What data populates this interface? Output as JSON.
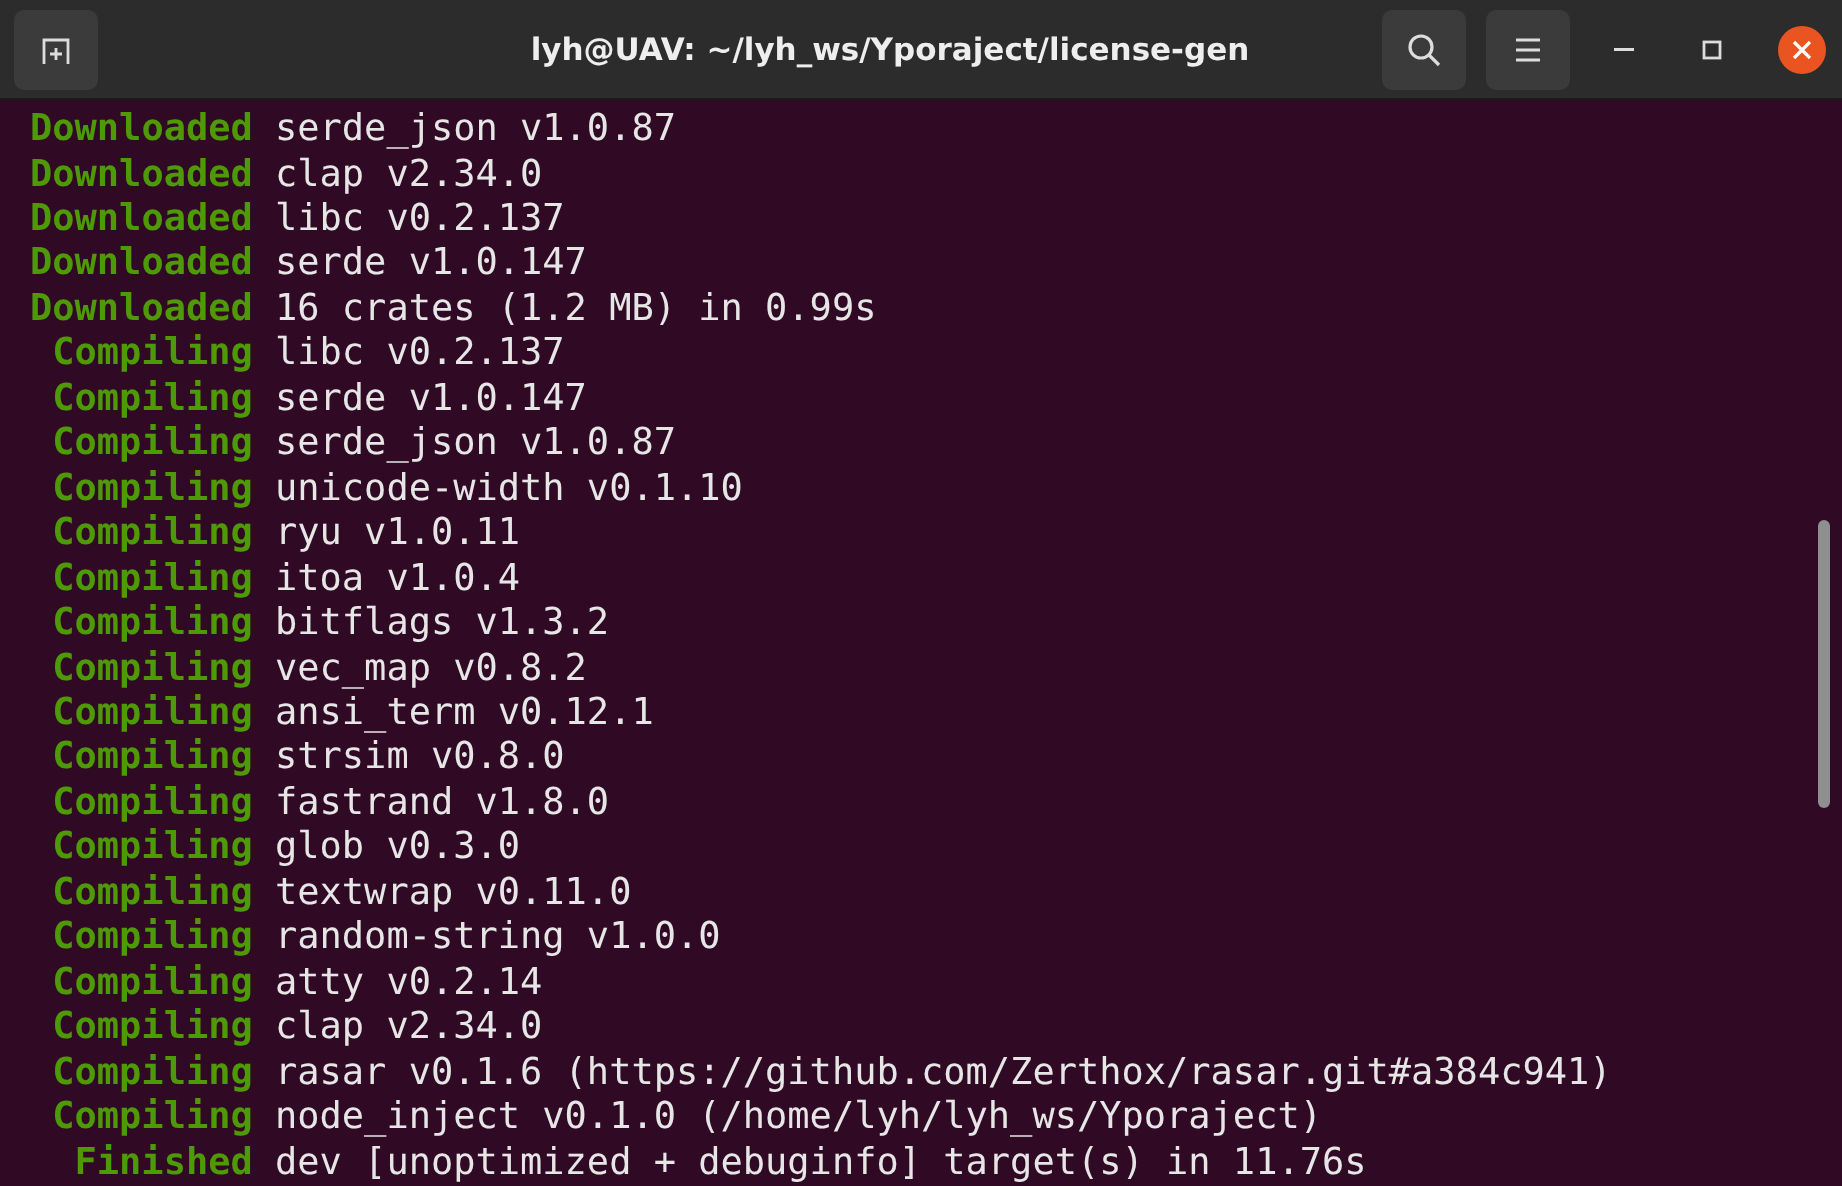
{
  "window": {
    "title": "lyh@UAV: ~/lyh_ws/Yporaject/license-gen"
  },
  "lines": [
    {
      "status": "Downloaded",
      "text": "serde_json v1.0.87"
    },
    {
      "status": "Downloaded",
      "text": "clap v2.34.0"
    },
    {
      "status": "Downloaded",
      "text": "libc v0.2.137"
    },
    {
      "status": "Downloaded",
      "text": "serde v1.0.147"
    },
    {
      "status": "Downloaded",
      "text": "16 crates (1.2 MB) in 0.99s"
    },
    {
      "status": "Compiling",
      "text": "libc v0.2.137"
    },
    {
      "status": "Compiling",
      "text": "serde v1.0.147"
    },
    {
      "status": "Compiling",
      "text": "serde_json v1.0.87"
    },
    {
      "status": "Compiling",
      "text": "unicode-width v0.1.10"
    },
    {
      "status": "Compiling",
      "text": "ryu v1.0.11"
    },
    {
      "status": "Compiling",
      "text": "itoa v1.0.4"
    },
    {
      "status": "Compiling",
      "text": "bitflags v1.3.2"
    },
    {
      "status": "Compiling",
      "text": "vec_map v0.8.2"
    },
    {
      "status": "Compiling",
      "text": "ansi_term v0.12.1"
    },
    {
      "status": "Compiling",
      "text": "strsim v0.8.0"
    },
    {
      "status": "Compiling",
      "text": "fastrand v1.8.0"
    },
    {
      "status": "Compiling",
      "text": "glob v0.3.0"
    },
    {
      "status": "Compiling",
      "text": "textwrap v0.11.0"
    },
    {
      "status": "Compiling",
      "text": "random-string v1.0.0"
    },
    {
      "status": "Compiling",
      "text": "atty v0.2.14"
    },
    {
      "status": "Compiling",
      "text": "clap v2.34.0"
    },
    {
      "status": "Compiling",
      "text": "rasar v0.1.6 (https://github.com/Zerthox/rasar.git#a384c941)"
    },
    {
      "status": "Compiling",
      "text": "node_inject v0.1.0 (/home/lyh/lyh_ws/Yporaject)"
    },
    {
      "status": "Finished",
      "text": "dev [unoptimized + debuginfo] target(s) in 11.76s"
    }
  ]
}
